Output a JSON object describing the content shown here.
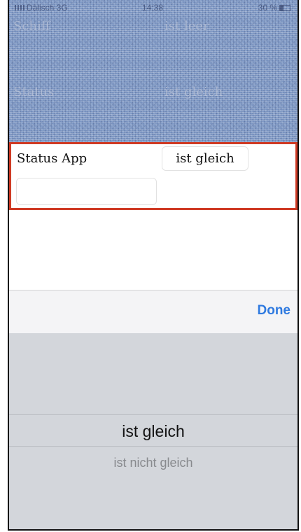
{
  "status_bar": {
    "carrier": "Dälisch 3G",
    "time": "14:38",
    "battery": "30 %"
  },
  "background_rows": [
    {
      "field": "Schiff",
      "operator": "ist leer"
    },
    {
      "field": "Status",
      "operator": "ist gleich"
    }
  ],
  "filter": {
    "field_label": "Status App",
    "operator": "ist gleich",
    "value": "",
    "highlight_color": "#cf3a24"
  },
  "toolbar": {
    "done_label": "Done",
    "accent_color": "#2f7ae0"
  },
  "picker": {
    "options": [
      "ist gleich",
      "ist nicht gleich"
    ],
    "selected": "ist gleich"
  }
}
